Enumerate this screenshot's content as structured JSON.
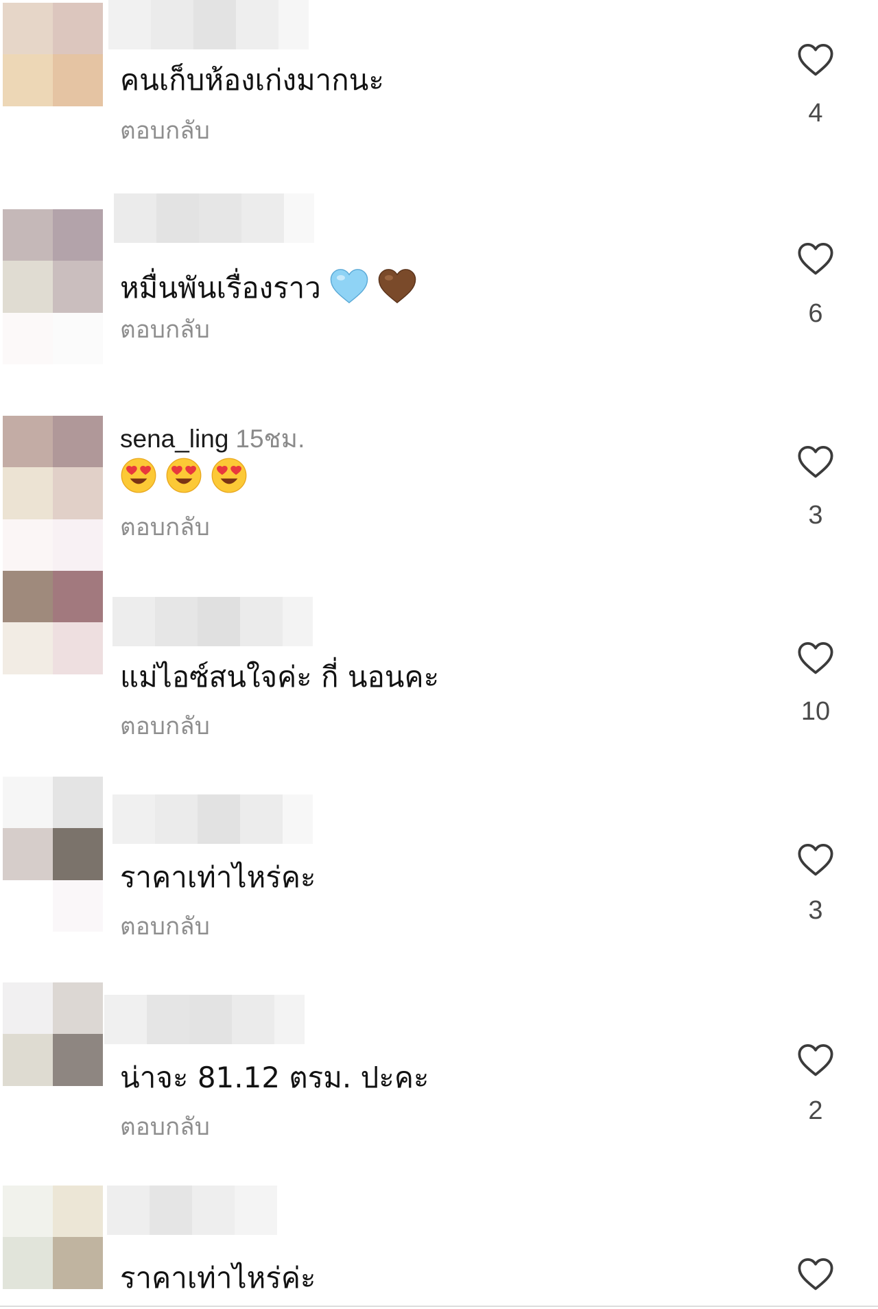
{
  "comments": [
    {
      "username": "",
      "time": "",
      "text": "คนเก็บห้องเก่งมากนะ",
      "reply_label": "ตอบกลับ",
      "likes": "4",
      "avatar_colors": [
        "#e6d6c8",
        "#dcc6be",
        "#edd7b6",
        "#e5c4a3",
        "#ffffff",
        "#ffffff"
      ],
      "name_blur_colors": [
        "#f1f1f1",
        "#ebebeb",
        "#e3e3e3",
        "#eeeeee",
        "#f6f6f6"
      ]
    },
    {
      "username": "",
      "time": "",
      "text": "หมื่นพันเรื่องราว",
      "reply_label": "ตอบกลับ",
      "likes": "6",
      "avatar_colors": [
        "#c5b8b8",
        "#b3a3aa",
        "#e0dcd2",
        "#cabebe",
        "#fcf9f9",
        "#fbfbfb"
      ],
      "name_blur_colors": [
        "#ebebeb",
        "#e3e3e3",
        "#e6e6e6",
        "#ececec",
        "#f8f8f8"
      ],
      "emoji": [
        "light-blue-heart",
        "brown-heart"
      ]
    },
    {
      "username": "sena_ling",
      "time": "15ชม.",
      "text": "",
      "reply_label": "ตอบกลับ",
      "likes": "3",
      "avatar_colors": [
        "#c3aca5",
        "#b09899",
        "#ece3d3",
        "#e1d0c8",
        "#fbf6f6",
        "#f8f1f4"
      ],
      "name_blur_colors": [],
      "emoji": [
        "heart-eyes",
        "heart-eyes",
        "heart-eyes"
      ]
    },
    {
      "username": "",
      "time": "",
      "text": "แม่ไอซ์สนใจค่ะ  กี่ นอนคะ",
      "reply_label": "ตอบกลับ",
      "likes": "10",
      "avatar_colors": [
        "#9f8a7c",
        "#a2797e",
        "#f2ece4",
        "#eedfe0",
        "#ffffff",
        "#ffffff"
      ],
      "name_blur_colors": [
        "#ededed",
        "#e6e6e6",
        "#e0e0e0",
        "#ebebeb",
        "#f3f3f3"
      ]
    },
    {
      "username": "",
      "time": "",
      "text": "ราคาเท่าไหร่คะ",
      "reply_label": "ตอบกลับ",
      "likes": "3",
      "avatar_colors": [
        "#f6f6f6",
        "#e4e4e4",
        "#d6cdca",
        "#7b736b",
        "#ffffff",
        "#faf7f9"
      ],
      "name_blur_colors": [
        "#f0f0f0",
        "#ebebeb",
        "#e2e2e2",
        "#ececec",
        "#f7f7f7"
      ]
    },
    {
      "username": "",
      "time": "",
      "text": "น่าจะ 81.12 ตรม. ปะคะ",
      "reply_label": "ตอบกลับ",
      "likes": "2",
      "avatar_colors": [
        "#f1f0f1",
        "#dcd7d3",
        "#dedbd1",
        "#8e8681",
        "#ffffff",
        "#ffffff"
      ],
      "name_blur_colors": [
        "#f0f0f0",
        "#e5e5e5",
        "#e3e3e3",
        "#ebebeb",
        "#f3f3f3"
      ]
    },
    {
      "username": "",
      "time": "",
      "text": "ราคาเท่าไหร่ค่ะ",
      "reply_label": "",
      "likes": "",
      "avatar_colors": [
        "#f1f2ec",
        "#ece6d6",
        "#e1e4da",
        "#c0b4a0",
        "#ffffff",
        "#ffffff"
      ],
      "name_blur_colors": [
        "#eeeeee",
        "#e5e5e5",
        "#eeeeee",
        "#f4f4f4",
        "#ffffff"
      ]
    }
  ]
}
